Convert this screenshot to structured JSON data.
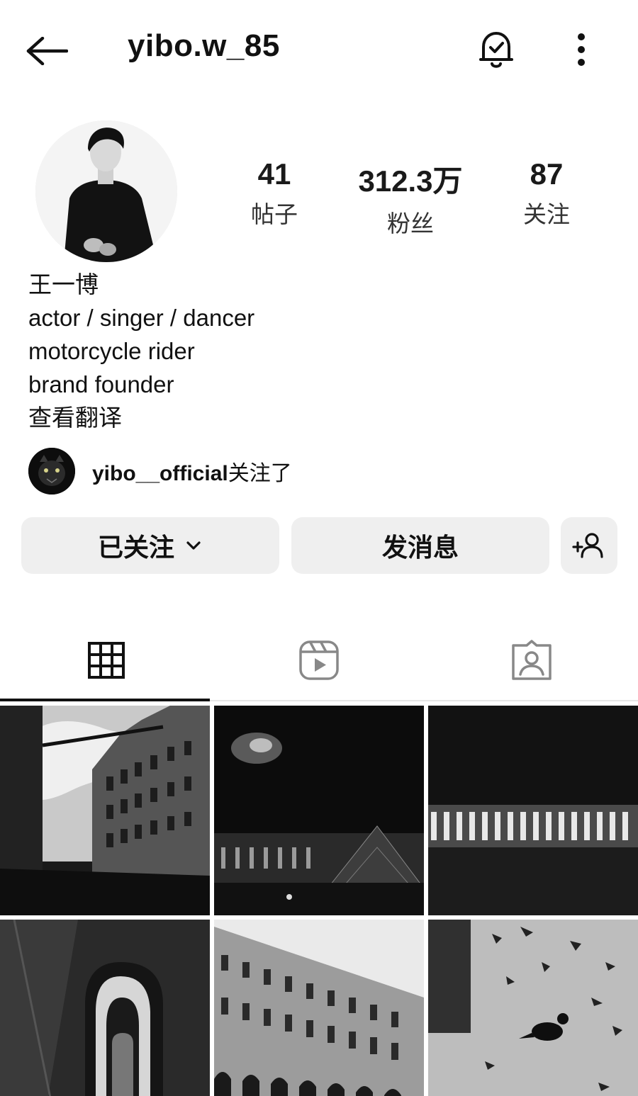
{
  "header": {
    "username": "yibo.w_85",
    "back_icon": "arrow-left-icon",
    "bell_icon": "notification-bell-check-icon",
    "more_icon": "more-vertical-icon"
  },
  "stats": {
    "posts": {
      "value": "41",
      "label": "帖子"
    },
    "followers": {
      "value": "312.3万",
      "label": "粉丝"
    },
    "following": {
      "value": "87",
      "label": "关注"
    }
  },
  "bio": {
    "name": "王一博",
    "lines": [
      "actor / singer / dancer",
      "motorcycle rider",
      "brand founder"
    ],
    "translate": "查看翻译"
  },
  "mutual": {
    "account": "yibo__official",
    "suffix": "关注了"
  },
  "actions": {
    "following_label": "已关注",
    "message_label": "发消息",
    "add_user_icon": "person-add-icon"
  },
  "tabs": [
    {
      "name": "posts",
      "icon": "grid-icon",
      "active": true
    },
    {
      "name": "reels",
      "icon": "reels-icon",
      "active": false
    },
    {
      "name": "tagged",
      "icon": "tagged-user-icon",
      "active": false
    }
  ],
  "posts": [
    {
      "alt": "building-with-sky"
    },
    {
      "alt": "louvre-at-night"
    },
    {
      "alt": "lit-colonnade-at-night"
    },
    {
      "alt": "spiral-staircase"
    },
    {
      "alt": "rivoli-arcade-building"
    },
    {
      "alt": "pigeon-on-ground"
    }
  ]
}
